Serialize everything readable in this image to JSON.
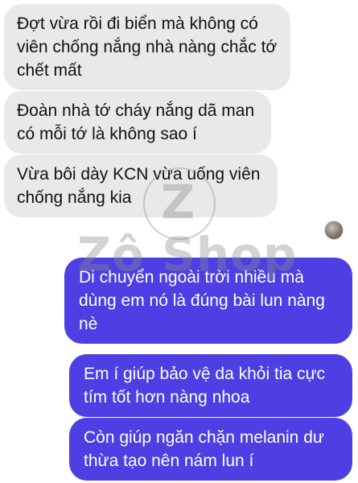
{
  "messages_incoming": [
    {
      "text": "Đợt vừa rồi đi biển mà không có viên chống nắng nhà nàng chắc tớ chết mất"
    },
    {
      "text": "Đoàn nhà tớ cháy nắng dã man có mỗi tớ là không sao í"
    },
    {
      "text": "Vừa bôi dày KCN vừa uống viên chống nắng kia"
    }
  ],
  "messages_outgoing": [
    {
      "text": "Di chuyển ngoài trời nhiều mà dùng em nó là đúng bài lun nàng nè"
    },
    {
      "text": "Em í giúp bảo vệ da khỏi tia cực tím tốt hơn nàng nhoa"
    },
    {
      "text": "Còn giúp ngăn chặn melanin dư thừa tạo nên nám lun í"
    }
  ],
  "watermark": {
    "logo_letter": "Z",
    "text": "Zô Shop"
  },
  "colors": {
    "incoming_bubble": "#e9e9eb",
    "outgoing_bubble": "#4d3fe3"
  },
  "icons": {
    "avatar": "contact-avatar"
  }
}
